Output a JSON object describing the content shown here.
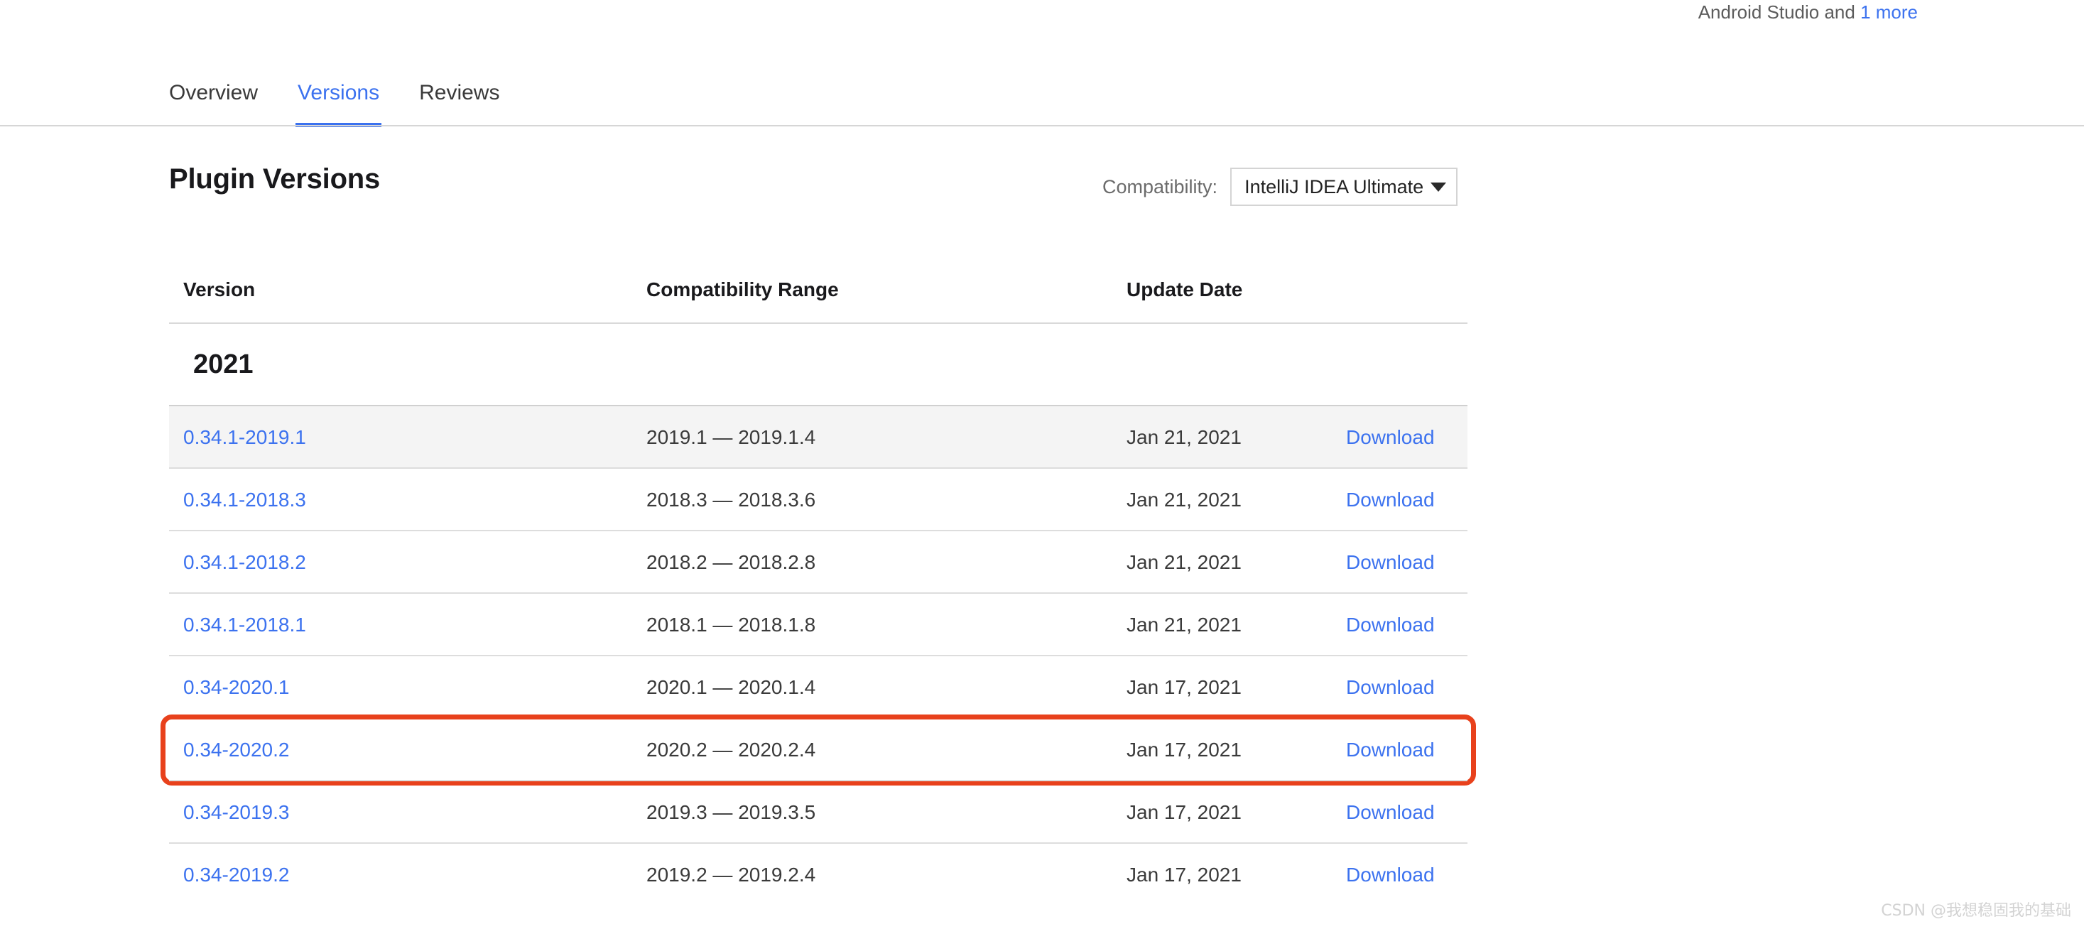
{
  "header": {
    "meta_prefix": "Android Studio and ",
    "meta_link": "1 more"
  },
  "tabs": [
    {
      "label": "Overview",
      "active": false
    },
    {
      "label": "Versions",
      "active": true
    },
    {
      "label": "Reviews",
      "active": false
    }
  ],
  "main": {
    "page_title": "Plugin Versions",
    "compatibility_label": "Compatibility:",
    "compatibility_value": "IntelliJ IDEA Ultimate",
    "compatibility_options": [
      "IntelliJ IDEA Ultimate"
    ],
    "caret_icon": "chevron-down-icon",
    "columns": [
      "Version",
      "Compatibility Range",
      "Update Date"
    ],
    "year_group": "2021",
    "download_label": "Download",
    "rows": [
      {
        "version": "0.34.1-2019.1",
        "range": "2019.1 — 2019.1.4",
        "date": "Jan 21, 2021",
        "download": "Download",
        "shaded": true,
        "highlighted": false
      },
      {
        "version": "0.34.1-2018.3",
        "range": "2018.3 — 2018.3.6",
        "date": "Jan 21, 2021",
        "download": "Download",
        "shaded": false,
        "highlighted": false
      },
      {
        "version": "0.34.1-2018.2",
        "range": "2018.2 — 2018.2.8",
        "date": "Jan 21, 2021",
        "download": "Download",
        "shaded": false,
        "highlighted": false
      },
      {
        "version": "0.34.1-2018.1",
        "range": "2018.1 — 2018.1.8",
        "date": "Jan 21, 2021",
        "download": "Download",
        "shaded": false,
        "highlighted": false
      },
      {
        "version": "0.34-2020.1",
        "range": "2020.1 — 2020.1.4",
        "date": "Jan 17, 2021",
        "download": "Download",
        "shaded": false,
        "highlighted": false
      },
      {
        "version": "0.34-2020.2",
        "range": "2020.2 — 2020.2.4",
        "date": "Jan 17, 2021",
        "download": "Download",
        "shaded": false,
        "highlighted": true
      },
      {
        "version": "0.34-2019.3",
        "range": "2019.3 — 2019.3.5",
        "date": "Jan 17, 2021",
        "download": "Download",
        "shaded": false,
        "highlighted": false
      },
      {
        "version": "0.34-2019.2",
        "range": "2019.2 — 2019.2.4",
        "date": "Jan 17, 2021",
        "download": "Download",
        "shaded": false,
        "highlighted": false
      }
    ]
  },
  "watermark": "CSDN @我想稳固我的基础",
  "colors": {
    "link": "#3c72ef",
    "text": "#19191c",
    "muted": "#6b6b6b",
    "annotation": "#e8411c",
    "row_shade": "#f4f4f4"
  }
}
